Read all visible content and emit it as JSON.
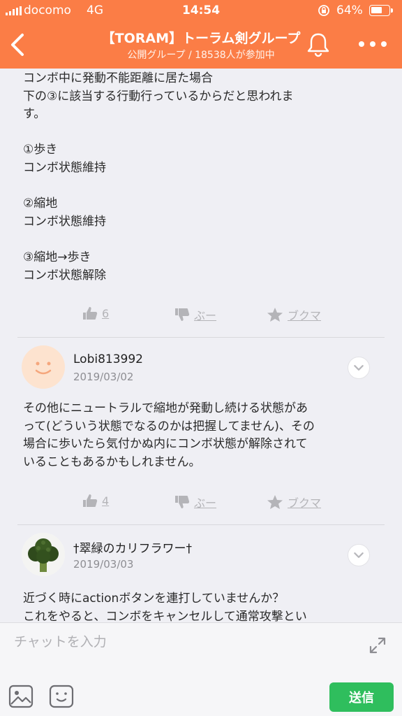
{
  "status_bar": {
    "carrier": "docomo",
    "network": "4G",
    "time": "14:54",
    "battery": "64%",
    "battery_level": 0.64
  },
  "nav": {
    "title": "【TORAM】トーラム剣グループ",
    "subtitle": "公開グループ / 18538人が参加中",
    "icons": [
      "back-arrow-icon",
      "bell-icon",
      "more-icon"
    ]
  },
  "posts": [
    {
      "text": "コンボ中に発動不能距離に居た場合\n下の③に該当する行動行っているからだと思われま\nす。\n\n①歩き\nコンボ状態維持\n\n②縮地\nコンボ状態維持\n\n③縮地→歩き\nコンボ状態解除",
      "actions": {
        "like": "6",
        "boo": "ぶー",
        "bookmark": "ブクマ"
      }
    },
    {
      "author": "Lobi813992",
      "date": "2019/03/02",
      "avatar": "smile-face-icon",
      "text": "その他にニュートラルで縮地が発動し続ける状態があ\nって(どういう状態でなるのかは把握してません)、その\n場合に歩いたら気付かぬ内にコンボ状態が解除されて\nいることもあるかもしれません。",
      "actions": {
        "like": "4",
        "boo": "ぶー",
        "bookmark": "ブクマ"
      }
    },
    {
      "author": "†翠緑のカリフラワー†",
      "date": "2019/03/03",
      "avatar": "broccoli-image",
      "text": "近づく時にactionボタンを連打していませんか？\nこれをやると、コンボをキャンセルして通常攻撃とい"
    }
  ],
  "composer": {
    "placeholder": "チャットを入力",
    "send_label": "送信"
  },
  "colors": {
    "header": "#fb7d46",
    "send": "#2fbe5d",
    "background": "#efeff4"
  }
}
